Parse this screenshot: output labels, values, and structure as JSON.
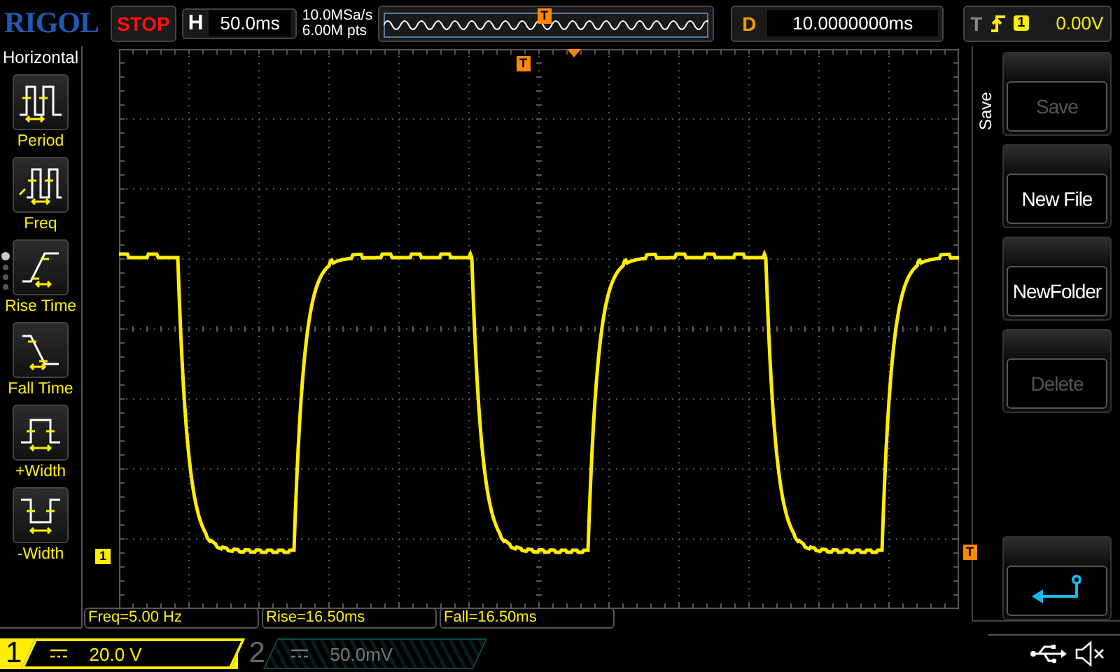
{
  "brand": "RIGOL",
  "run_state": {
    "label": "STOP"
  },
  "horizontal": {
    "label": "H",
    "timebase": "50.0ms"
  },
  "acquisition": {
    "sample_rate": "10.0MSa/s",
    "memory_depth": "6.00M pts"
  },
  "overview": {
    "trigger_marker": "T"
  },
  "delay": {
    "label": "D",
    "value": "10.0000000ms"
  },
  "trigger": {
    "label": "T",
    "source": "1",
    "level": "0.00V"
  },
  "left_menu": {
    "title": "Horizontal",
    "items": [
      {
        "label": "Period",
        "kind": "period"
      },
      {
        "label": "Freq",
        "kind": "freq"
      },
      {
        "label": "Rise Time",
        "kind": "rise"
      },
      {
        "label": "Fall Time",
        "kind": "fall"
      },
      {
        "label": "+Width",
        "kind": "pwidth"
      },
      {
        "label": "-Width",
        "kind": "nwidth"
      }
    ],
    "pages": [
      {
        "selected": true
      },
      {
        "selected": false
      },
      {
        "selected": false
      },
      {
        "selected": false
      }
    ]
  },
  "plot": {
    "trigger_position_marker": "T",
    "channel_marker": "1",
    "trigger_level_marker": "T"
  },
  "right_menu": {
    "title": "Save",
    "items": [
      {
        "kind": "text",
        "label": "Save",
        "disabled": true
      },
      {
        "kind": "text",
        "label": "New File",
        "disabled": false
      },
      {
        "kind": "text",
        "label": "NewFolder",
        "disabled": false
      },
      {
        "kind": "text",
        "label": "Delete",
        "disabled": true
      },
      {
        "kind": "back"
      }
    ]
  },
  "measurements": [
    "Freq=5.00 Hz",
    "Rise=16.50ms",
    "Fall=16.50ms"
  ],
  "channels": [
    {
      "number": "1",
      "scale": "20.0 V",
      "selected": true
    },
    {
      "number": "2",
      "scale": "50.0mV",
      "selected": false
    }
  ]
}
